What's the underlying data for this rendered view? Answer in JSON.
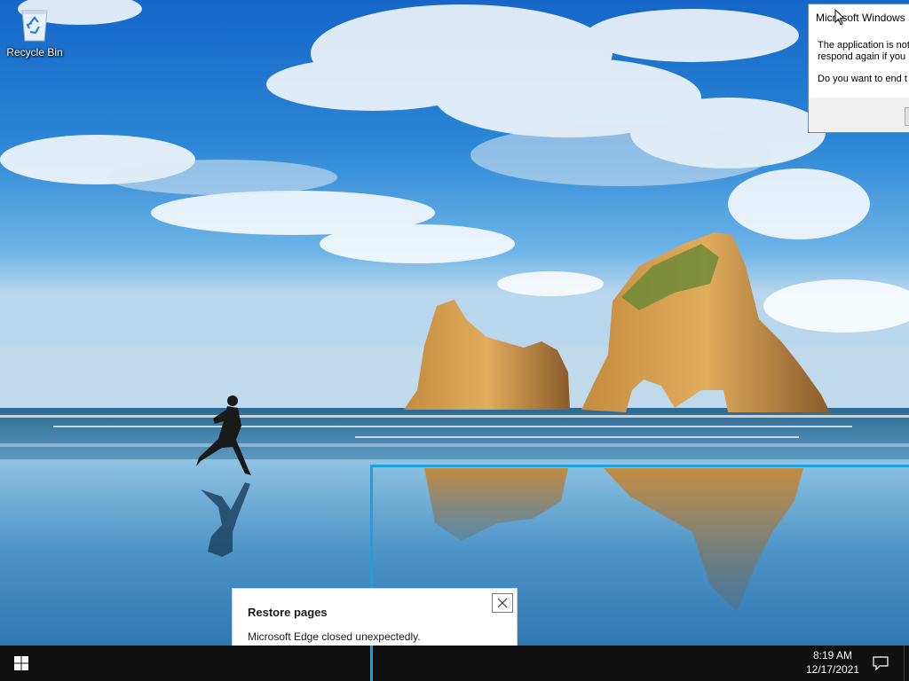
{
  "desktop": {
    "icons": [
      {
        "label": "Recycle Bin",
        "icon": "recycle-bin-icon"
      }
    ]
  },
  "message_box": {
    "title": "Microsoft Windows",
    "line1": "The application is not",
    "line2": "respond again if you",
    "question": "Do you want to end t"
  },
  "toast": {
    "title": "Restore pages",
    "body": "Microsoft Edge closed unexpectedly.",
    "close_icon": "close-icon"
  },
  "taskbar": {
    "start_icon": "windows-logo-icon",
    "time": "8:19 AM",
    "date": "12/17/2021",
    "notification_icon": "action-center-icon"
  },
  "colors": {
    "accent": "#1ba1e2",
    "taskbar": "#101010"
  }
}
